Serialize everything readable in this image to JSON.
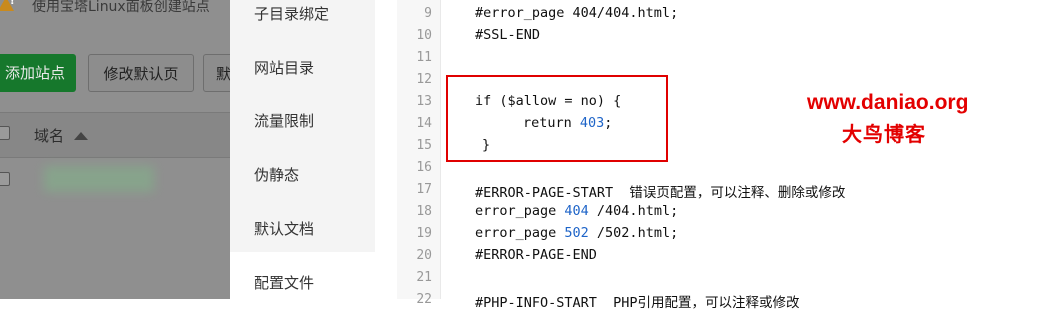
{
  "background_page": {
    "notice": "使用宝塔Linux面板创建站点",
    "toolbar": {
      "add_site": "添加站点",
      "modify_default": "修改默认页",
      "cut_button": "默"
    },
    "table": {
      "domain_header": "域名"
    }
  },
  "settings_menu": {
    "items": [
      "子目录绑定",
      "网站目录",
      "流量限制",
      "伪静态",
      "默认文档",
      "配置文件"
    ],
    "active": "配置文件"
  },
  "editor": {
    "line_numbers": [
      "9",
      "10",
      "11",
      "12",
      "13",
      "14",
      "15",
      "16",
      "17",
      "18",
      "19",
      "20",
      "21",
      "22"
    ],
    "lines": [
      {
        "text": "#error_page 404/404.html;"
      },
      {
        "text": "#SSL-END"
      },
      {
        "text": ""
      },
      {
        "text": ""
      },
      {
        "text": "if ($allow = no) {"
      },
      {
        "pre": "return ",
        "num": "403",
        "post": ";"
      },
      {
        "text": "}"
      },
      {
        "text": ""
      },
      {
        "text": "#ERROR-PAGE-START  错误页配置，可以注释、删除或修改"
      },
      {
        "pre": "error_page ",
        "num": "404",
        "post": " /404.html;"
      },
      {
        "pre": "error_page ",
        "num": "502",
        "post": " /502.html;"
      },
      {
        "text": "#ERROR-PAGE-END"
      },
      {
        "text": ""
      },
      {
        "text": "#PHP-INFO-START  PHP引用配置，可以注释或修改"
      }
    ]
  },
  "watermark": {
    "url": "www.daniao.org",
    "name": "大鸟博客"
  },
  "colors": {
    "highlight_border": "#e00000",
    "watermark": "#e30000",
    "number": "#1e64c8",
    "add_button": "#16782c"
  }
}
